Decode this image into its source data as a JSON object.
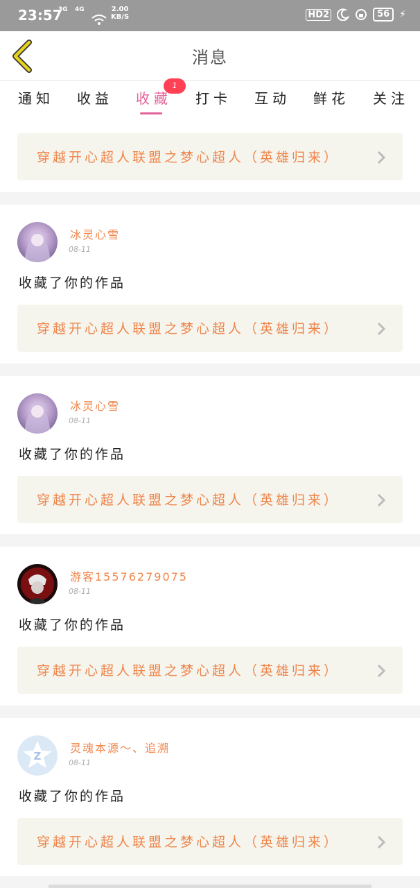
{
  "status_bar": {
    "time": "23:57",
    "net1": "3G",
    "net2": "4G",
    "speed_value": "2.00",
    "speed_unit": "KB/S",
    "hd": "HD2",
    "battery": "56"
  },
  "header": {
    "title": "消息"
  },
  "tabs": [
    {
      "label": "通知"
    },
    {
      "label": "收益"
    },
    {
      "label": "收藏"
    },
    {
      "label": "打卡"
    },
    {
      "label": "互动"
    },
    {
      "label": "鲜花"
    },
    {
      "label": "关注"
    }
  ],
  "active_tab_badge": "1",
  "top_work": {
    "title": "穿越开心超人联盟之梦心超人（英雄归来）"
  },
  "entries": [
    {
      "user": "冰灵心雪",
      "date": "08-11",
      "action": "收藏了你的作品",
      "work": "穿越开心超人联盟之梦心超人（英雄归来）",
      "avatar": "anime-avatar"
    },
    {
      "user": "冰灵心雪",
      "date": "08-11",
      "action": "收藏了你的作品",
      "work": "穿越开心超人联盟之梦心超人（英雄归来）",
      "avatar": "anime-avatar"
    },
    {
      "user": "游客15576279075",
      "date": "08-11",
      "action": "收藏了你的作品",
      "work": "穿越开心超人联盟之梦心超人（英雄归来）",
      "avatar": "dark-anime-avatar"
    },
    {
      "user": "灵魂本源～、追溯",
      "date": "08-11",
      "action": "收藏了你的作品",
      "work": "穿越开心超人联盟之梦心超人（英雄归来）",
      "avatar": "default-qq-avatar"
    }
  ],
  "colors": {
    "accent": "#e2649a",
    "orange": "#f08448",
    "badge": "#ff4055",
    "back_arrow": "#d9c21a"
  }
}
